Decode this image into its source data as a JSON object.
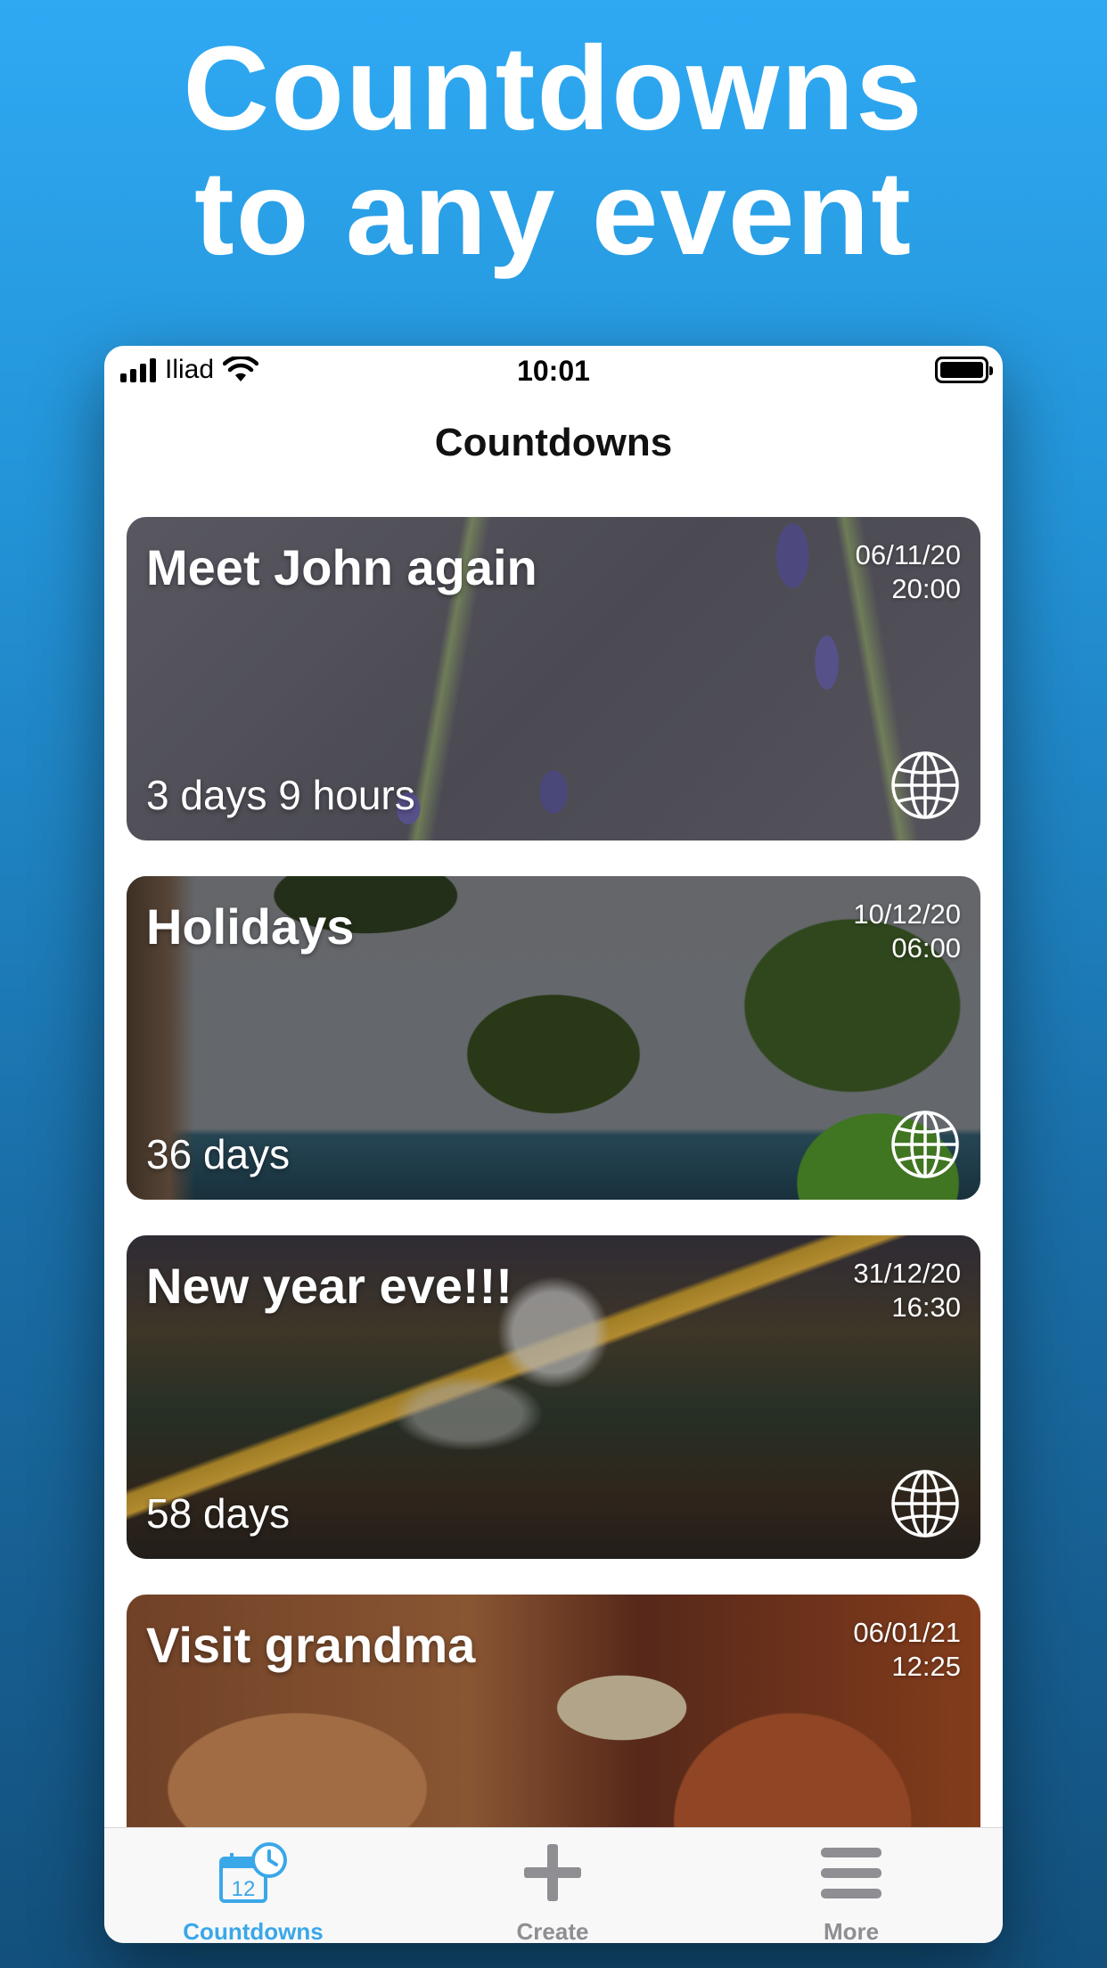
{
  "headline": {
    "line1": "Countdowns",
    "line2": "to any event"
  },
  "status_bar": {
    "carrier": "Iliad",
    "time": "10:01"
  },
  "nav": {
    "title": "Countdowns"
  },
  "events": [
    {
      "title": "Meet John again",
      "date": "06/11/20",
      "time": "20:00",
      "remaining": "3 days 9 hours",
      "background": "lavender"
    },
    {
      "title": "Holidays",
      "date": "10/12/20",
      "time": "06:00",
      "remaining": "36 days",
      "background": "tropical"
    },
    {
      "title": "New year eve!!!",
      "date": "31/12/20",
      "time": "16:30",
      "remaining": "58 days",
      "background": "fireworks"
    },
    {
      "title": "Visit grandma",
      "date": "06/01/21",
      "time": "12:25",
      "remaining": "",
      "background": "grandma"
    }
  ],
  "tabs": [
    {
      "label": "Countdowns",
      "icon": "calendar-clock-icon",
      "active": true
    },
    {
      "label": "Create",
      "icon": "plus-icon",
      "active": false
    },
    {
      "label": "More",
      "icon": "hamburger-icon",
      "active": false
    }
  ],
  "colors": {
    "accent": "#3aa7e8",
    "inactive_tab": "#8e8e93",
    "background_top": "#2fa9f3",
    "background_bottom": "#13507c"
  }
}
